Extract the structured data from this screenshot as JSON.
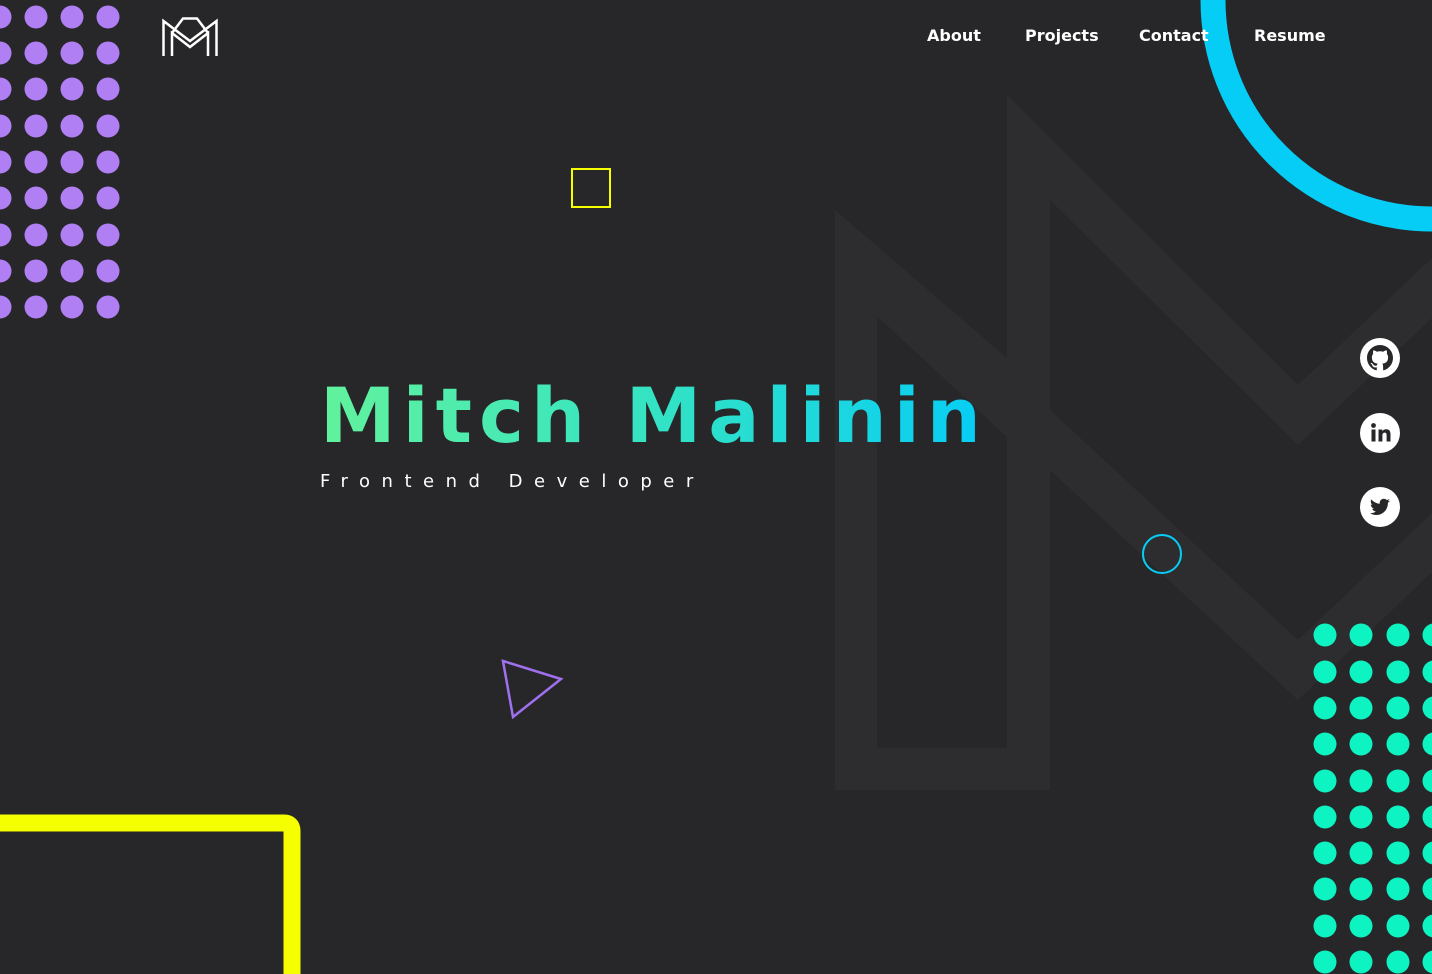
{
  "header": {
    "logo_icon": "mm-monogram-logo-icon",
    "nav": [
      {
        "label": "About"
      },
      {
        "label": "Projects"
      },
      {
        "label": "Contact"
      },
      {
        "label": "Resume"
      }
    ]
  },
  "hero": {
    "name": "Mitch Malinin",
    "role": "Frontend Developer"
  },
  "social": [
    {
      "icon": "github-icon"
    },
    {
      "icon": "linkedin-icon"
    },
    {
      "icon": "twitter-icon"
    }
  ],
  "decor": {
    "dot_grid_left_icon": "dot-grid-pattern-icon",
    "dot_grid_right_icon": "dot-grid-pattern-icon",
    "square_outline_icon": "square-outline-icon",
    "circle_outline_icon": "circle-outline-icon",
    "triangle_outline_icon": "triangle-outline-icon"
  },
  "colors": {
    "background": "#272729",
    "watermark": "#2d2d2f",
    "purple_dots": "#b07ff4",
    "teal_dots": "#0ef3c2",
    "cyan_ring": "#06cdf5",
    "yellow": "#f6ff00",
    "gradient_start": "#62f29d",
    "gradient_end": "#06cdf5",
    "text": "#ffffff"
  }
}
